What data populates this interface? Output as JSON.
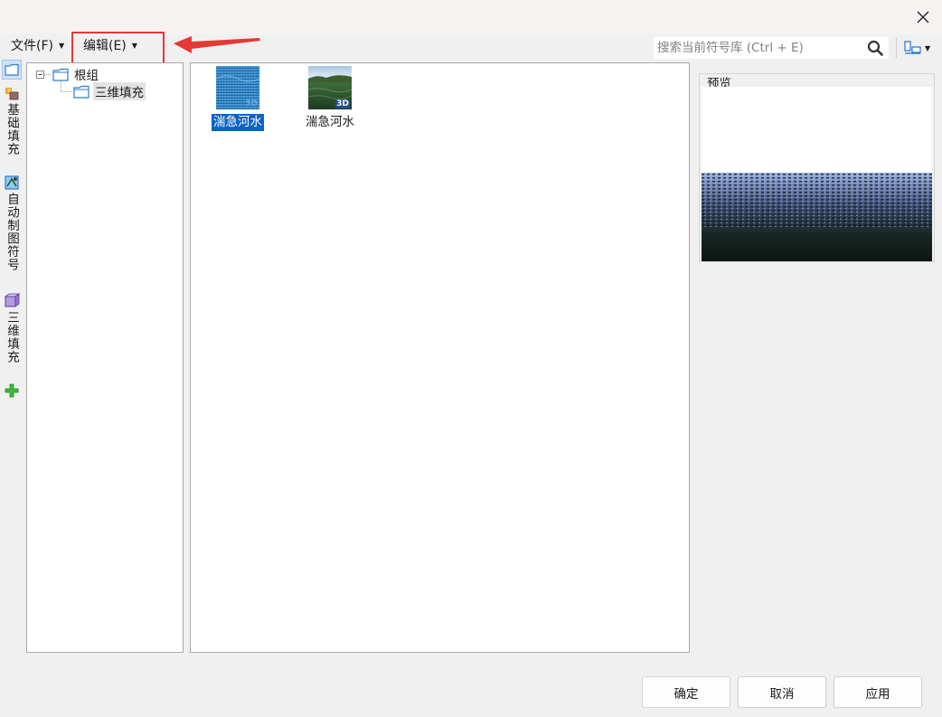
{
  "menu": {
    "file": "文件(F)",
    "edit": "编辑(E)"
  },
  "search": {
    "placeholder": "搜索当前符号库 (Ctrl + E)"
  },
  "left_tabs": [
    {
      "label": "基础填充",
      "icon": "fill-icon"
    },
    {
      "label": "自动制图符号",
      "icon": "auto-symbol-icon"
    },
    {
      "label": "三维填充",
      "icon": "3d-fill-icon"
    }
  ],
  "tree": {
    "root": "根组",
    "child": "三维填充"
  },
  "symbols": [
    {
      "label": "湍急河水",
      "selected": true,
      "badge": "3D"
    },
    {
      "label": "湍急河水",
      "selected": false,
      "badge": "3D"
    }
  ],
  "preview": {
    "title": "预览"
  },
  "buttons": {
    "ok": "确定",
    "cancel": "取消",
    "apply": "应用"
  },
  "colors": {
    "accent": "#0a64c8",
    "annotation": "#e53935",
    "water_deep": "#0d1a14",
    "water_light": "#6f87b8"
  }
}
